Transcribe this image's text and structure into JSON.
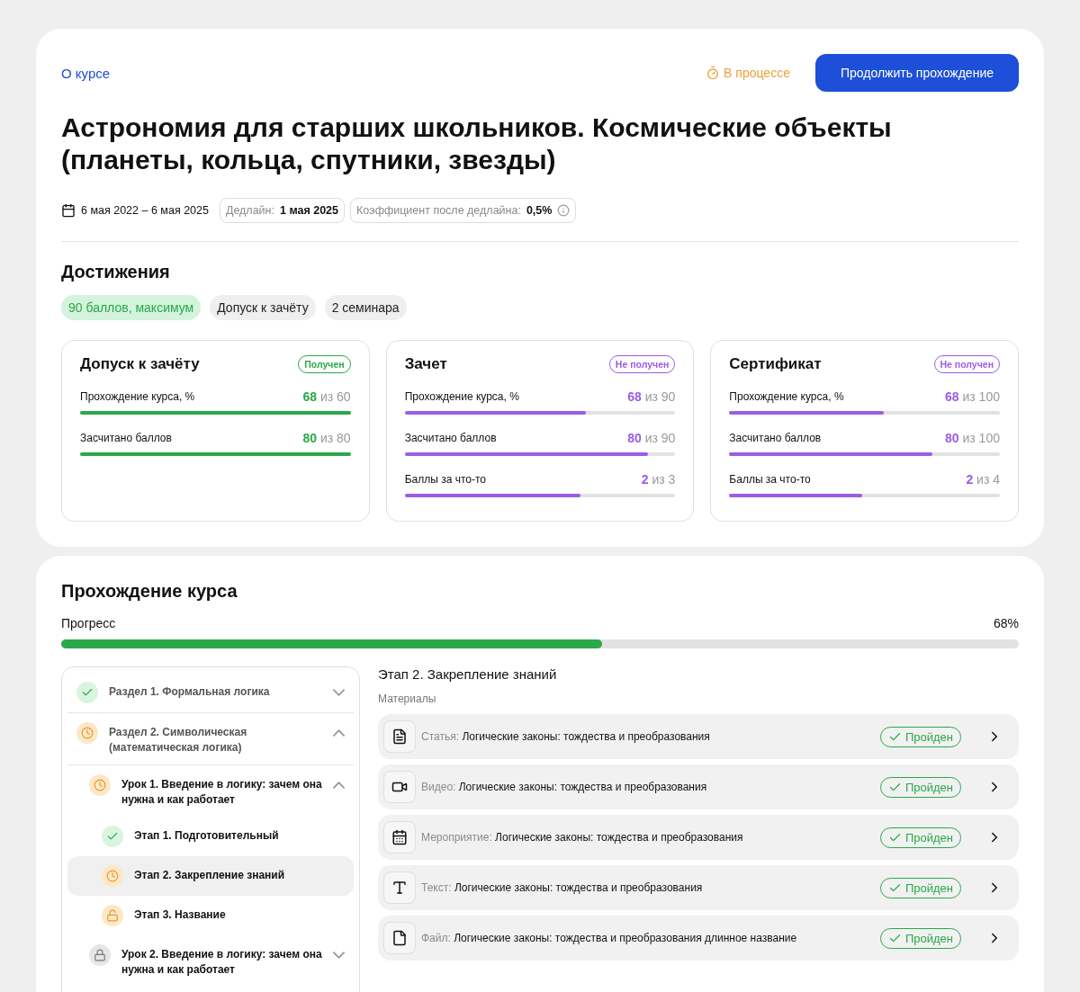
{
  "header": {
    "about_link": "О курсе",
    "status": "В процессе",
    "continue_button": "Продолжить прохождение"
  },
  "course_title": "Астрономия для старших школьников. Космические объекты (планеты, кольца, спутники, звезды)",
  "meta": {
    "dates": "6 мая 2022 – 6 мая 2025",
    "deadline_label": "Дедлайн:",
    "deadline_value": "1 мая 2025",
    "coef_label": "Коэффициент после дедлайна:",
    "coef_value": "0,5%"
  },
  "achievements": {
    "title": "Достижения",
    "tags": [
      {
        "label": "90 баллов, максимум",
        "highlighted": true
      },
      {
        "label": "Допуск к зачёту",
        "highlighted": false
      },
      {
        "label": "2 семинара",
        "highlighted": false
      }
    ],
    "cards": [
      {
        "title": "Допуск к зачёту",
        "badge": "Получен",
        "received": true,
        "metrics": [
          {
            "label": "Прохождение курса, %",
            "value": "68",
            "of": "из 60",
            "level": 1
          },
          {
            "label": "Засчитано баллов",
            "value": "80",
            "of": "из 80",
            "level": 1
          }
        ]
      },
      {
        "title": "Зачет",
        "badge": "Не получен",
        "received": false,
        "metrics": [
          {
            "label": "Прохождение курса, %",
            "value": "68",
            "of": "из 90",
            "level": 0.67
          },
          {
            "label": "Засчитано баллов",
            "value": "80",
            "of": "из 90",
            "level": 0.9
          },
          {
            "label": "Баллы за что-то",
            "value": "2",
            "of": "из 3",
            "level": 0.65
          }
        ]
      },
      {
        "title": "Сертификат",
        "badge": "Не получен",
        "received": false,
        "metrics": [
          {
            "label": "Прохождение курса, %",
            "value": "68",
            "of": "из 100",
            "level": 0.57
          },
          {
            "label": "Засчитано баллов",
            "value": "80",
            "of": "из 100",
            "level": 0.75
          },
          {
            "label": "Баллы за что-то",
            "value": "2",
            "of": "из 4",
            "level": 0.49
          }
        ]
      }
    ]
  },
  "course_progress": {
    "title": "Прохождение курса",
    "progress_label": "Прогресс",
    "progress_value": "68%",
    "level": 0.565
  },
  "tree": [
    {
      "title": "Раздел 1. Формальная логика",
      "kind": "done",
      "expanded": false,
      "selected": false
    },
    {
      "title": "Раздел 2. Символическая (математическая логика)",
      "kind": "progress",
      "expanded": true,
      "selected": false,
      "children": [
        {
          "title": "Урок 1. Введение в логику: зачем она нужна и как работает",
          "kind": "progress",
          "expanded": true,
          "selected": false,
          "children": [
            {
              "title": "Этап 1. Подготовительный",
              "kind": "done",
              "selected": false
            },
            {
              "title": "Этап 2. Закрепление знаний",
              "kind": "progress",
              "selected": true
            },
            {
              "title": "Этап 3. Название",
              "kind": "open",
              "selected": false
            }
          ]
        },
        {
          "title": "Урок 2. Введение в логику: зачем она нужна и как работает",
          "kind": "locked",
          "expanded": false,
          "selected": false
        }
      ]
    }
  ],
  "stage": {
    "title": "Этап 2. Закрепление знаний",
    "materials_label": "Материалы",
    "materials": [
      {
        "kind": "article",
        "type": "Статья:",
        "name": "Логические законы: тождества и преобразования",
        "status": "Пройден"
      },
      {
        "kind": "video",
        "type": "Видео:",
        "name": "Логические законы: тождества и преобразования",
        "status": "Пройден"
      },
      {
        "kind": "event",
        "type": "Мероприятие:",
        "name": "Логические законы: тождества и преобразования",
        "status": "Пройден"
      },
      {
        "kind": "text",
        "type": "Текст:",
        "name": "Логические законы: тождества и преобразования",
        "status": "Пройден"
      },
      {
        "kind": "file",
        "type": "Файл:",
        "name": "Логические законы: тождества и преобразования длинное название",
        "status": "Пройден"
      }
    ]
  }
}
